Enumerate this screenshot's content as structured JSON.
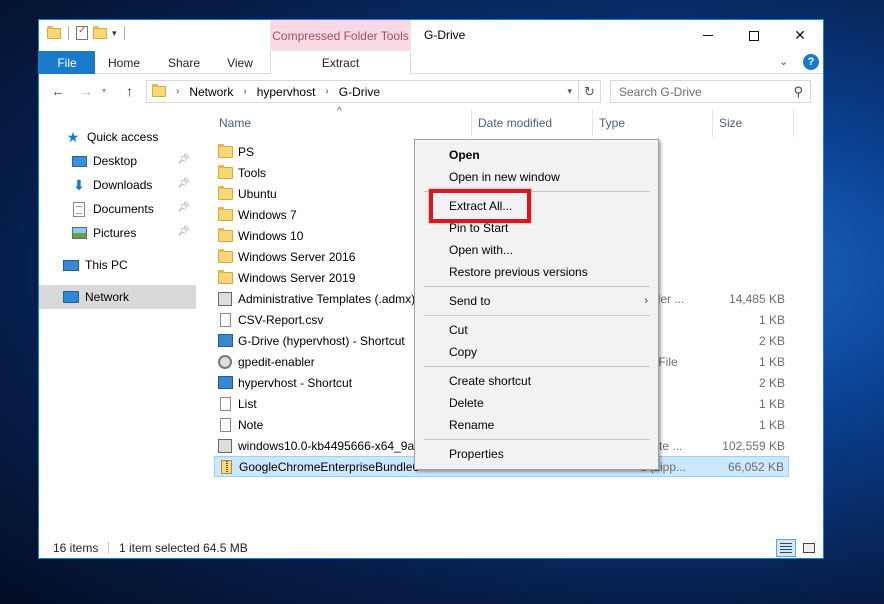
{
  "window": {
    "title": "G-Drive",
    "contextual_tab_group": "Compressed Folder Tools"
  },
  "ribbon": {
    "tabs": [
      "File",
      "Home",
      "Share",
      "View",
      "Extract"
    ]
  },
  "address": {
    "crumbs": [
      "Network",
      "hypervhost",
      "G-Drive"
    ],
    "search_placeholder": "Search G-Drive"
  },
  "nav_pane": {
    "items": [
      {
        "label": "Quick access",
        "icon": "star-icon"
      },
      {
        "label": "Desktop",
        "icon": "desktop-icon",
        "pinned": true
      },
      {
        "label": "Downloads",
        "icon": "download-icon",
        "pinned": true
      },
      {
        "label": "Documents",
        "icon": "documents-icon",
        "pinned": true
      },
      {
        "label": "Pictures",
        "icon": "pictures-icon",
        "pinned": true
      },
      {
        "label": "This PC",
        "icon": "this-pc-icon"
      },
      {
        "label": "Network",
        "icon": "network-icon",
        "selected": true
      }
    ]
  },
  "columns": [
    "Name",
    "Date modified",
    "Type",
    "Size"
  ],
  "files": [
    {
      "name": "PS",
      "type": "",
      "size": "",
      "icon": "folder-icon"
    },
    {
      "name": "Tools",
      "type": "",
      "size": "",
      "icon": "folder-icon"
    },
    {
      "name": "Ubuntu",
      "type": "",
      "size": "",
      "icon": "folder-icon"
    },
    {
      "name": "Windows 7",
      "type": "",
      "size": "",
      "icon": "folder-icon"
    },
    {
      "name": "Windows 10",
      "type": "",
      "size": "",
      "icon": "folder-icon"
    },
    {
      "name": "Windows Server 2016",
      "type": "",
      "size": "",
      "icon": "folder-icon"
    },
    {
      "name": "Windows Server 2019",
      "type": "",
      "size": "",
      "icon": "folder-icon"
    },
    {
      "name": "Administrative Templates (.admx)",
      "type": "staller ...",
      "size": "14,485 KB",
      "icon": "installer-icon"
    },
    {
      "name": "CSV-Report.csv",
      "type": "",
      "size": "1 KB",
      "icon": "file-icon"
    },
    {
      "name": "G-Drive (hypervhost) - Shortcut",
      "type": "",
      "size": "2 KB",
      "icon": "shortcut-icon"
    },
    {
      "name": "gpedit-enabler",
      "type": "tch File",
      "size": "1 KB",
      "icon": "gear-icon"
    },
    {
      "name": "hypervhost - Shortcut",
      "type": "",
      "size": "2 KB",
      "icon": "shortcut-icon"
    },
    {
      "name": "List",
      "type": "ent",
      "size": "1 KB",
      "icon": "file-icon"
    },
    {
      "name": "Note",
      "type": "ent",
      "size": "1 KB",
      "icon": "file-icon"
    },
    {
      "name": "windows10.0-kb4495666-x64_9a38",
      "type": "pdate ...",
      "size": "102,559 KB",
      "icon": "msu-icon"
    },
    {
      "name": "GoogleChromeEnterpriseBundle6",
      "type": "d (zipp...",
      "size": "66,052 KB",
      "icon": "zip-icon",
      "selected": true
    }
  ],
  "context_menu": {
    "items": [
      {
        "label": "Open",
        "bold": true
      },
      {
        "label": "Open in new window"
      },
      {
        "label": "Extract All..."
      },
      {
        "label": "Pin to Start"
      },
      {
        "label": "Open with..."
      },
      {
        "label": "Restore previous versions"
      },
      {
        "label": "Send to",
        "submenu": true
      },
      {
        "label": "Cut"
      },
      {
        "label": "Copy"
      },
      {
        "label": "Create shortcut"
      },
      {
        "label": "Delete"
      },
      {
        "label": "Rename"
      },
      {
        "label": "Properties"
      }
    ]
  },
  "status": {
    "count": "16 items",
    "selection": "1 item selected  64.5 MB"
  },
  "colors": {
    "accent": "#1979ca",
    "selection": "#cce8ff",
    "highlight_box": "#e0151b",
    "contextual_tab": "#f9d9e6"
  }
}
